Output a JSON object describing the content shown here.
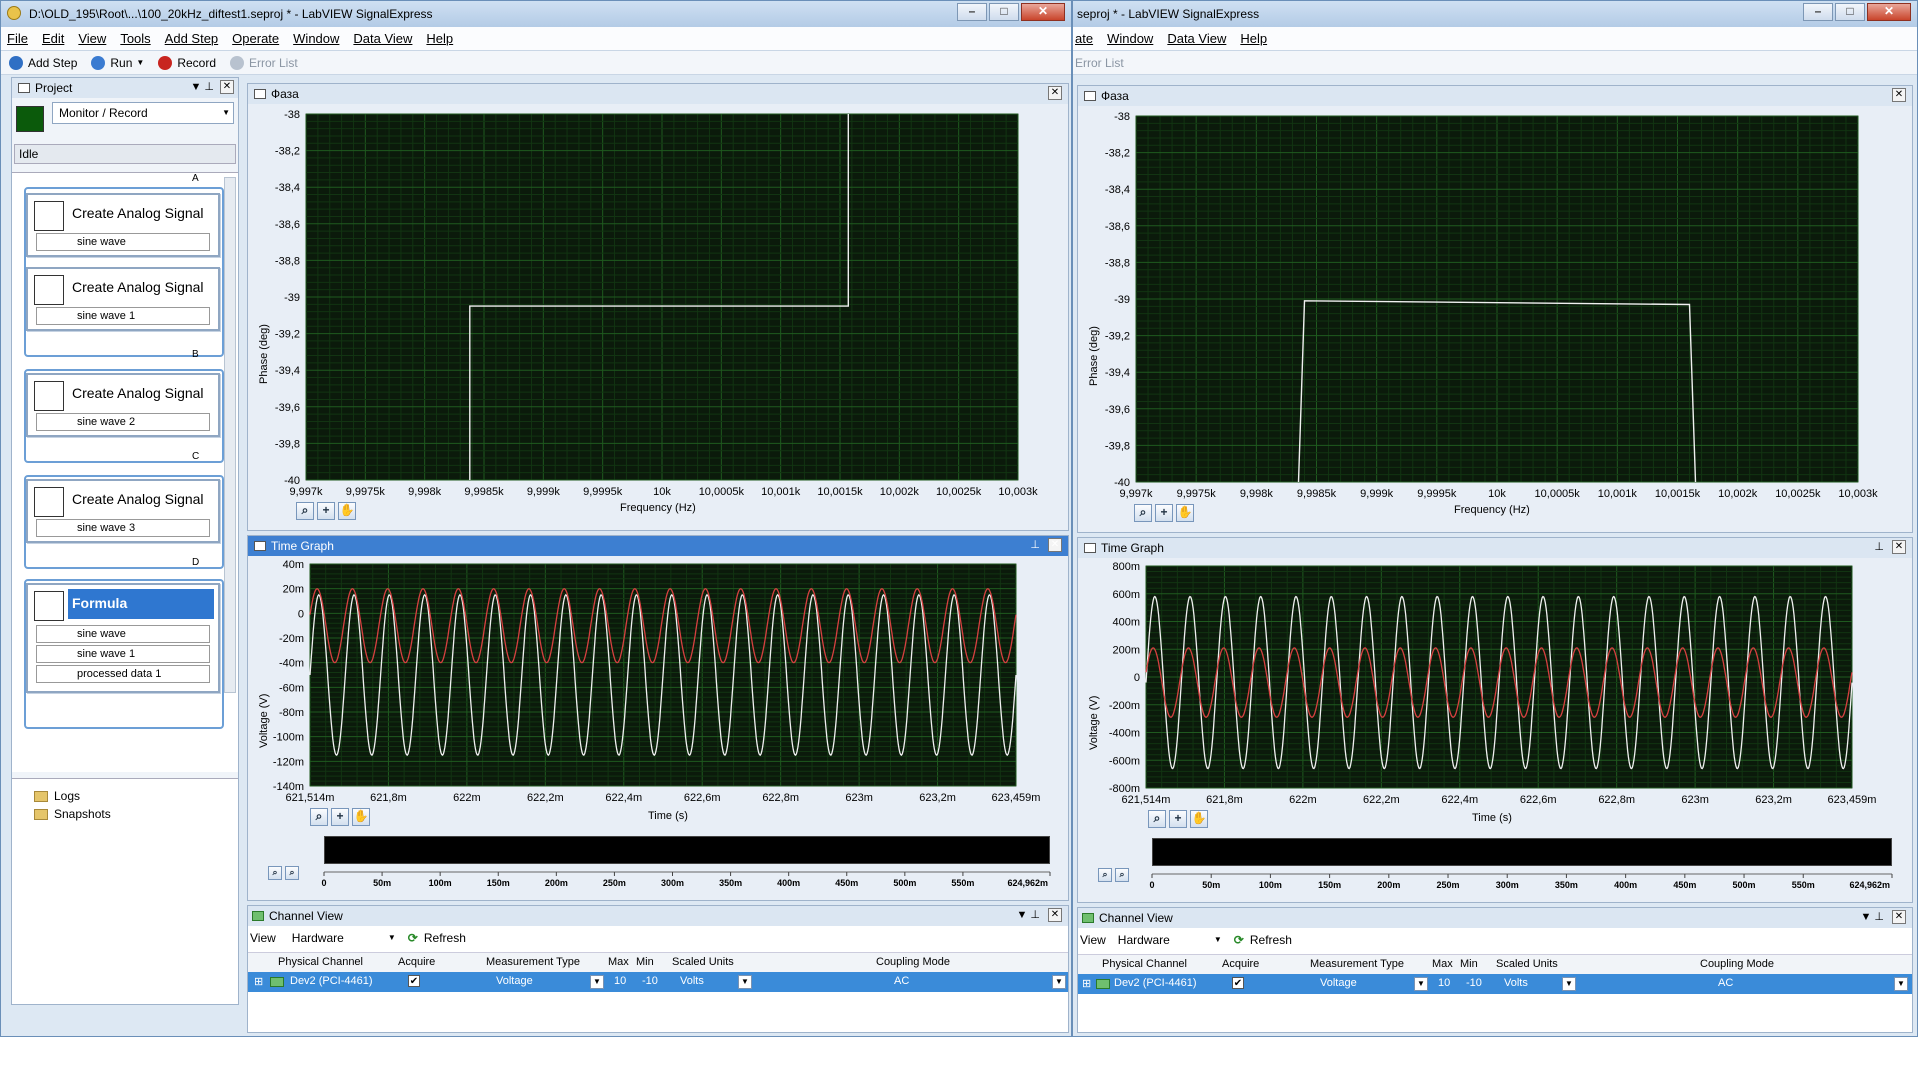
{
  "left_window": {
    "title": "D:\\OLD_195\\Root\\...\\100_20kHz_diftest1.seproj * - LabVIEW SignalExpress",
    "menu": [
      "File",
      "Edit",
      "View",
      "Tools",
      "Add Step",
      "Operate",
      "Window",
      "Data View",
      "Help"
    ],
    "toolbar": {
      "add_step": "Add Step",
      "run": "Run",
      "record": "Record",
      "error_list": "Error List"
    },
    "project": {
      "header": "Project",
      "mode": "Monitor / Record",
      "status": "Idle",
      "groups": [
        "A",
        "B",
        "C",
        "D"
      ],
      "steps": [
        {
          "title": "Create Analog Signal",
          "output": "sine wave"
        },
        {
          "title": "Create Analog Signal",
          "output": "sine wave 1"
        },
        {
          "title": "Create Analog Signal",
          "output": "sine wave 2"
        },
        {
          "title": "Create Analog Signal",
          "output": "sine wave 3"
        }
      ],
      "formula": {
        "title": "Formula",
        "inputs": [
          "sine wave",
          "sine wave 1"
        ],
        "output": "processed data 1"
      },
      "tree": [
        "Logs",
        "Snapshots"
      ]
    },
    "phase_panel": {
      "title": "Фаза",
      "ylabel": "Phase (deg)",
      "xlabel": "Frequency (Hz)",
      "yticks": [
        "-38",
        "-38,2",
        "-38,4",
        "-38,6",
        "-38,8",
        "-39",
        "-39,2",
        "-39,4",
        "-39,6",
        "-39,8",
        "-40"
      ],
      "xticks": [
        "9,997k",
        "9,9975k",
        "9,998k",
        "9,9985k",
        "9,999k",
        "9,9995k",
        "10k",
        "10,0005k",
        "10,001k",
        "10,0015k",
        "10,002k",
        "10,0025k",
        "10,003k"
      ]
    },
    "time_panel": {
      "title": "Time Graph",
      "ylabel": "Voltage (V)",
      "xlabel": "Time (s)",
      "yticks": [
        "40m",
        "20m",
        "0",
        "-20m",
        "-40m",
        "-60m",
        "-80m",
        "-100m",
        "-120m",
        "-140m"
      ],
      "xticks": [
        "621,514m",
        "621,8m",
        "622m",
        "622,2m",
        "622,4m",
        "622,6m",
        "622,8m",
        "623m",
        "623,2m",
        "623,459m"
      ],
      "overview_ticks": [
        "0",
        "50m",
        "100m",
        "150m",
        "200m",
        "250m",
        "300m",
        "350m",
        "400m",
        "450m",
        "500m",
        "550m",
        "624,962m"
      ]
    },
    "channel_view": {
      "title": "Channel View",
      "view_label": "View",
      "view_value": "Hardware",
      "refresh": "Refresh",
      "columns": [
        "Physical Channel",
        "Acquire",
        "Measurement Type",
        "Max",
        "Min",
        "Scaled Units",
        "Coupling Mode"
      ],
      "row": {
        "channel": "Dev2 (PCI-4461)",
        "acquire": "✔",
        "measurement": "Voltage",
        "max": "10",
        "min": "-10",
        "units": "Volts",
        "coupling": "AC"
      }
    }
  },
  "right_window": {
    "title": "seproj * - LabVIEW SignalExpress",
    "menu": [
      "ate",
      "Window",
      "Data View",
      "Help"
    ],
    "toolbar": {
      "error_list": "Error List"
    },
    "phase_panel": {
      "title": "Фаза",
      "ylabel": "Phase (deg)",
      "xlabel": "Frequency (Hz)",
      "yticks": [
        "-38",
        "-38,2",
        "-38,4",
        "-38,6",
        "-38,8",
        "-39",
        "-39,2",
        "-39,4",
        "-39,6",
        "-39,8",
        "-40"
      ],
      "xticks": [
        "9,997k",
        "9,9975k",
        "9,998k",
        "9,9985k",
        "9,999k",
        "9,9995k",
        "10k",
        "10,0005k",
        "10,001k",
        "10,0015k",
        "10,002k",
        "10,0025k",
        "10,003k"
      ]
    },
    "time_panel": {
      "title": "Time Graph",
      "ylabel": "Voltage (V)",
      "xlabel": "Time (s)",
      "yticks": [
        "800m",
        "600m",
        "400m",
        "200m",
        "0",
        "-200m",
        "-400m",
        "-600m",
        "-800m"
      ],
      "xticks": [
        "621,514m",
        "621,8m",
        "622m",
        "622,2m",
        "622,4m",
        "622,6m",
        "622,8m",
        "623m",
        "623,2m",
        "623,459m"
      ],
      "overview_ticks": [
        "0",
        "50m",
        "100m",
        "150m",
        "200m",
        "250m",
        "300m",
        "350m",
        "400m",
        "450m",
        "500m",
        "550m",
        "624,962m"
      ]
    },
    "channel_view": {
      "title": "Channel View",
      "view_label": "View",
      "view_value": "Hardware",
      "refresh": "Refresh",
      "columns": [
        "Physical Channel",
        "Acquire",
        "Measurement Type",
        "Max",
        "Min",
        "Scaled Units",
        "Coupling Mode"
      ],
      "row": {
        "channel": "Dev2 (PCI-4461)",
        "acquire": "✔",
        "measurement": "Voltage",
        "max": "10",
        "min": "-10",
        "units": "Volts",
        "coupling": "AC"
      }
    }
  },
  "chart_data": [
    {
      "type": "line",
      "title": "Фаза",
      "xlabel": "Frequency (Hz)",
      "ylabel": "Phase (deg)",
      "xlim": [
        9997,
        10003
      ],
      "ylim": [
        -40,
        -38
      ],
      "series": [
        {
          "x": [
            9998.38,
            9998.38,
            10001.57,
            10001.57
          ],
          "y": [
            -40,
            -39.05,
            -39.05,
            -38
          ]
        }
      ]
    },
    {
      "type": "line",
      "title": "Time Graph",
      "xlabel": "Time (s)",
      "ylabel": "Voltage (V)",
      "xlim": [
        0.621514,
        0.623459
      ],
      "ylim": [
        -0.14,
        0.04
      ],
      "series": [
        {
          "amplitude": 0.065,
          "offset": -0.05,
          "cycles": 20
        },
        {
          "amplitude": 0.03,
          "offset": -0.01,
          "cycles": 20
        }
      ]
    },
    {
      "type": "line",
      "title": "Фаза",
      "xlabel": "Frequency (Hz)",
      "ylabel": "Phase (deg)",
      "xlim": [
        9997,
        10003
      ],
      "ylim": [
        -40,
        -38
      ],
      "series": [
        {
          "x": [
            9998.35,
            9998.4,
            10001.6,
            10001.65
          ],
          "y": [
            -40,
            -39.01,
            -39.03,
            -40
          ]
        }
      ]
    },
    {
      "type": "line",
      "title": "Time Graph",
      "xlabel": "Time (s)",
      "ylabel": "Voltage (V)",
      "xlim": [
        0.621514,
        0.623459
      ],
      "ylim": [
        -0.8,
        0.8
      ],
      "series": [
        {
          "amplitude": 0.62,
          "offset": -0.04,
          "cycles": 20
        },
        {
          "amplitude": 0.25,
          "offset": -0.04,
          "cycles": 20
        }
      ]
    }
  ],
  "colors": {
    "plot_bg": "#0b1a0b",
    "grid": "#1e5a1e",
    "trace_white": "#f0f0f0",
    "trace_red": "#d64040",
    "active_header": "#3d7fd1"
  }
}
